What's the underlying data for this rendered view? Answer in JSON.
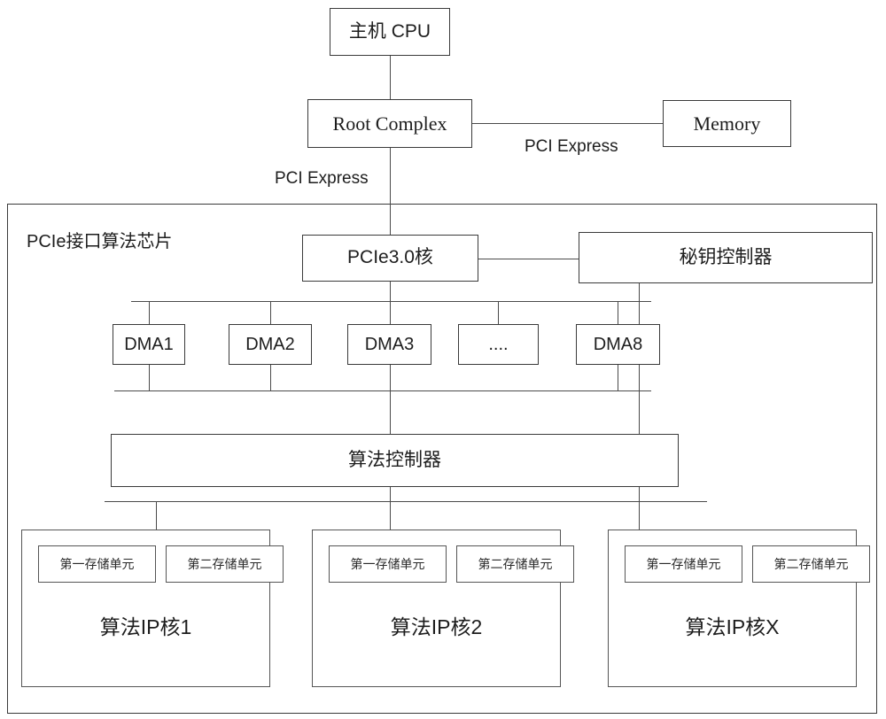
{
  "diagram": {
    "title": "PCIe接口算法芯片",
    "top": {
      "cpu": "主机 CPU",
      "root_complex": "Root Complex",
      "memory": "Memory",
      "pci_express_label_left": "PCI Express",
      "pci_express_label_right": "PCI Express"
    },
    "chip": {
      "label": "PCIe接口算法芯片",
      "pcie_core": "PCIe3.0核",
      "key_controller": "秘钥控制器",
      "algorithm_controller": "算法控制器",
      "dma": [
        {
          "label": "DMA1"
        },
        {
          "label": "DMA2"
        },
        {
          "label": "DMA3"
        },
        {
          "label": "...."
        },
        {
          "label": "DMA8"
        }
      ],
      "ip_cores": [
        {
          "title": "算法IP核1",
          "mem1": "第一存储单元",
          "mem2": "第二存储单元"
        },
        {
          "title": "算法IP核2",
          "mem1": "第一存储单元",
          "mem2": "第二存储单元"
        },
        {
          "title": "算法IP核X",
          "mem1": "第一存储单元",
          "mem2": "第二存储单元"
        }
      ]
    }
  },
  "colors": {
    "line": "#4a4a4a",
    "border": "#3a3a3a",
    "text": "#1d1d1d",
    "background": "#ffffff"
  }
}
